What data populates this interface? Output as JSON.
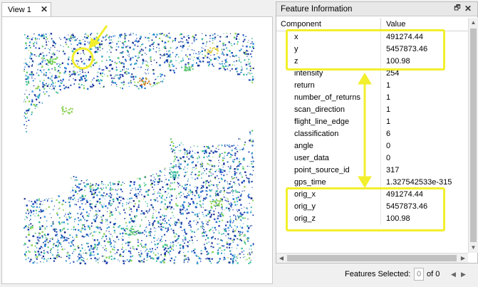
{
  "view": {
    "tab_label": "View 1",
    "close_glyph": "✕"
  },
  "feature_panel": {
    "title": "Feature Information",
    "float_glyph": "🗗",
    "close_glyph": "✕",
    "columns": [
      "Component",
      "Value"
    ],
    "rows": [
      {
        "component": "x",
        "value": "491274.44"
      },
      {
        "component": "y",
        "value": "5457873.46"
      },
      {
        "component": "z",
        "value": "100.98"
      },
      {
        "component": "intensity",
        "value": "254"
      },
      {
        "component": "return",
        "value": "1"
      },
      {
        "component": "number_of_returns",
        "value": "1"
      },
      {
        "component": "scan_direction",
        "value": "1"
      },
      {
        "component": "flight_line_edge",
        "value": "1"
      },
      {
        "component": "classification",
        "value": "6"
      },
      {
        "component": "angle",
        "value": "0"
      },
      {
        "component": "user_data",
        "value": "0"
      },
      {
        "component": "point_source_id",
        "value": "317"
      },
      {
        "component": "gps_time",
        "value": "1.327542533e-315"
      },
      {
        "component": "orig_x",
        "value": "491274.44"
      },
      {
        "component": "orig_y",
        "value": "5457873.46"
      },
      {
        "component": "orig_z",
        "value": "100.98"
      }
    ]
  },
  "status": {
    "label": "Features Selected:",
    "current": "0",
    "of_text": "of 0",
    "prev_glyph": "◀",
    "next_glyph": "▶"
  },
  "annotation_color": "#f2ef2c"
}
